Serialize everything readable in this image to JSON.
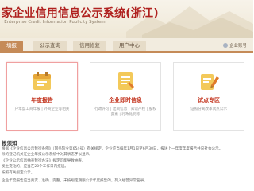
{
  "header": {
    "title": "家企业信用信息公示系统(浙江)",
    "subtitle": "l Enterprise Credit Information Publicity System"
  },
  "nav": {
    "tabs": [
      {
        "label": "填报"
      },
      {
        "label": "公示查询"
      },
      {
        "label": "信用修复"
      },
      {
        "label": "用户中心"
      }
    ],
    "login_label": "企业账号"
  },
  "cards": [
    {
      "title": "年度报告",
      "desc": "户年度工商年报 | 外商企业等相关",
      "icon": "calendar-icon"
    },
    {
      "title": "企业即时信息",
      "desc": "行政许可 | 出资信息 | 知识产权 | 股权变更 | 行政处罚等",
      "icon": "document-icon"
    },
    {
      "title": "试点专区",
      "desc": "证照分离改革试点公示",
      "icon": "pencil-icon"
    }
  ],
  "notice": {
    "title": "报须知",
    "lines": [
      "根据《企业信息公示暂行条例》（国务院令第654号）有关规定，企业应当每年1月1日至6月30日，报送上一年度年度报告并向社会公示。",
      "除的登记机关在企业年报公示系统中对其状态予以显示。",
      "《企业公示信息抽查暂行办法》规定可能导致抽查。",
      "发生变化的，应当在20个工作日内报送。",
      "按照有关规定公示。",
      "年报问题。"
    ],
    "footer": "企业年度报告应当真实、准确、完整。未按规定期限公示年度报告的，列入经营异常名录。"
  }
}
